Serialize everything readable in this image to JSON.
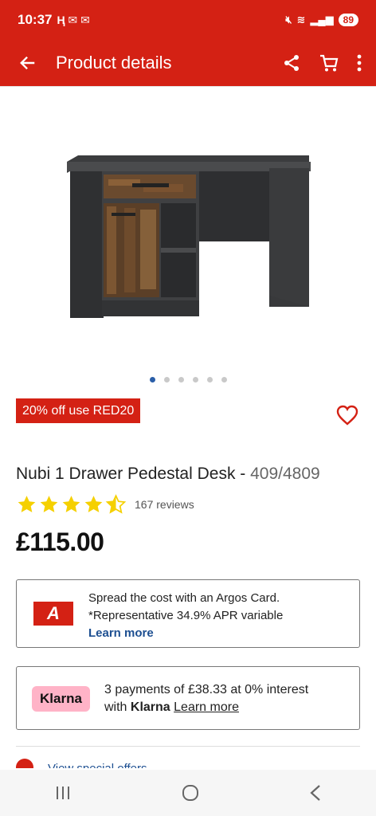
{
  "status_bar": {
    "time": "10:37",
    "battery": "89"
  },
  "app_bar": {
    "title": "Product details"
  },
  "gallery": {
    "total_images": 6,
    "active_index": 0
  },
  "promo": {
    "label": "20% off use RED20"
  },
  "product": {
    "name": "Nubi 1 Drawer Pedestal Desk - ",
    "code": "409/4809",
    "rating": 4.5,
    "reviews_label": "167 reviews",
    "price": "£115.00"
  },
  "argos_card": {
    "logo_letter": "A",
    "line1": "Spread the cost with an Argos Card.",
    "line2": "*Representative 34.9% APR variable",
    "learn_more": "Learn more"
  },
  "klarna": {
    "logo": "Klarna",
    "line1": "3 payments of £38.33 at 0% interest",
    "with": "with",
    "brand": "Klarna",
    "learn_more": "Learn more"
  },
  "peek": {
    "label": "View special offers"
  },
  "colors": {
    "brand_red": "#d42114",
    "link_blue": "#1d4f91",
    "star_yellow": "#f5d000",
    "klarna_pink": "#ffb3c7"
  },
  "icons": [
    "arrow-left-icon",
    "share-icon",
    "cart-icon",
    "more-vertical-icon",
    "heart-icon",
    "star-icon",
    "recents-icon",
    "home-icon",
    "back-nav-icon"
  ]
}
